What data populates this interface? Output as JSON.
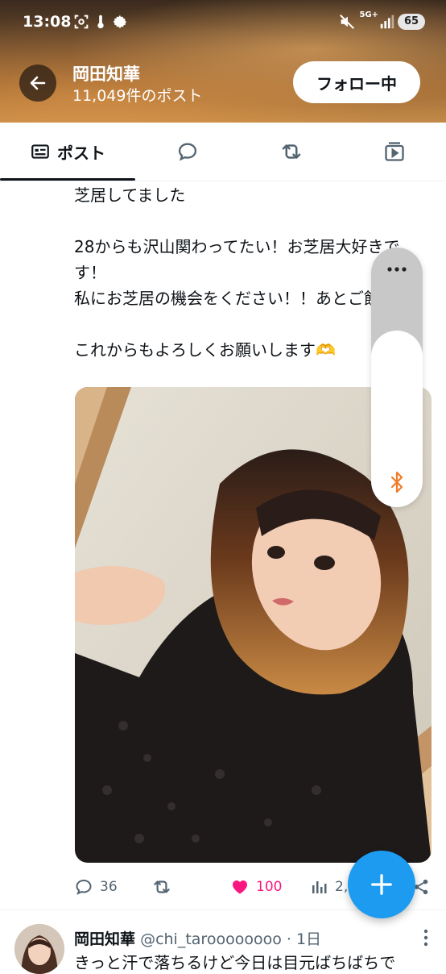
{
  "status_bar": {
    "time": "13:08",
    "network": "5G+",
    "battery": "65"
  },
  "header": {
    "name": "岡田知華",
    "post_count": "11,049件のポスト",
    "follow_label": "フォロー中"
  },
  "tabs": [
    {
      "label": "ポスト",
      "icon": "post-icon",
      "active": true
    },
    {
      "label": "",
      "icon": "reply-icon",
      "active": false
    },
    {
      "label": "",
      "icon": "retweet-icon",
      "active": false
    },
    {
      "label": "",
      "icon": "media-icon",
      "active": false
    }
  ],
  "tweet": {
    "text": "芝居してました\n\n28からも沢山関わってたい！お芝居大好きです！\n私にお芝居の機会をください！！あとご飯会も！\n\nこれからもよろしくお願いします🫶",
    "actions": {
      "replies": "36",
      "likes": "100",
      "views": "2,"
    }
  },
  "next_tweet": {
    "name": "岡田知華",
    "handle": "@chi_taroooooooo",
    "time": "1日",
    "text": "きっと汗で落ちるけど今日は目元ばちばちで"
  },
  "volume_overlay": {
    "level": 0.68
  },
  "colors": {
    "accent": "#1d9bf0",
    "like": "#f91880",
    "text": "#0f1419",
    "secondary": "#536471",
    "bluetooth": "#f07c28"
  }
}
